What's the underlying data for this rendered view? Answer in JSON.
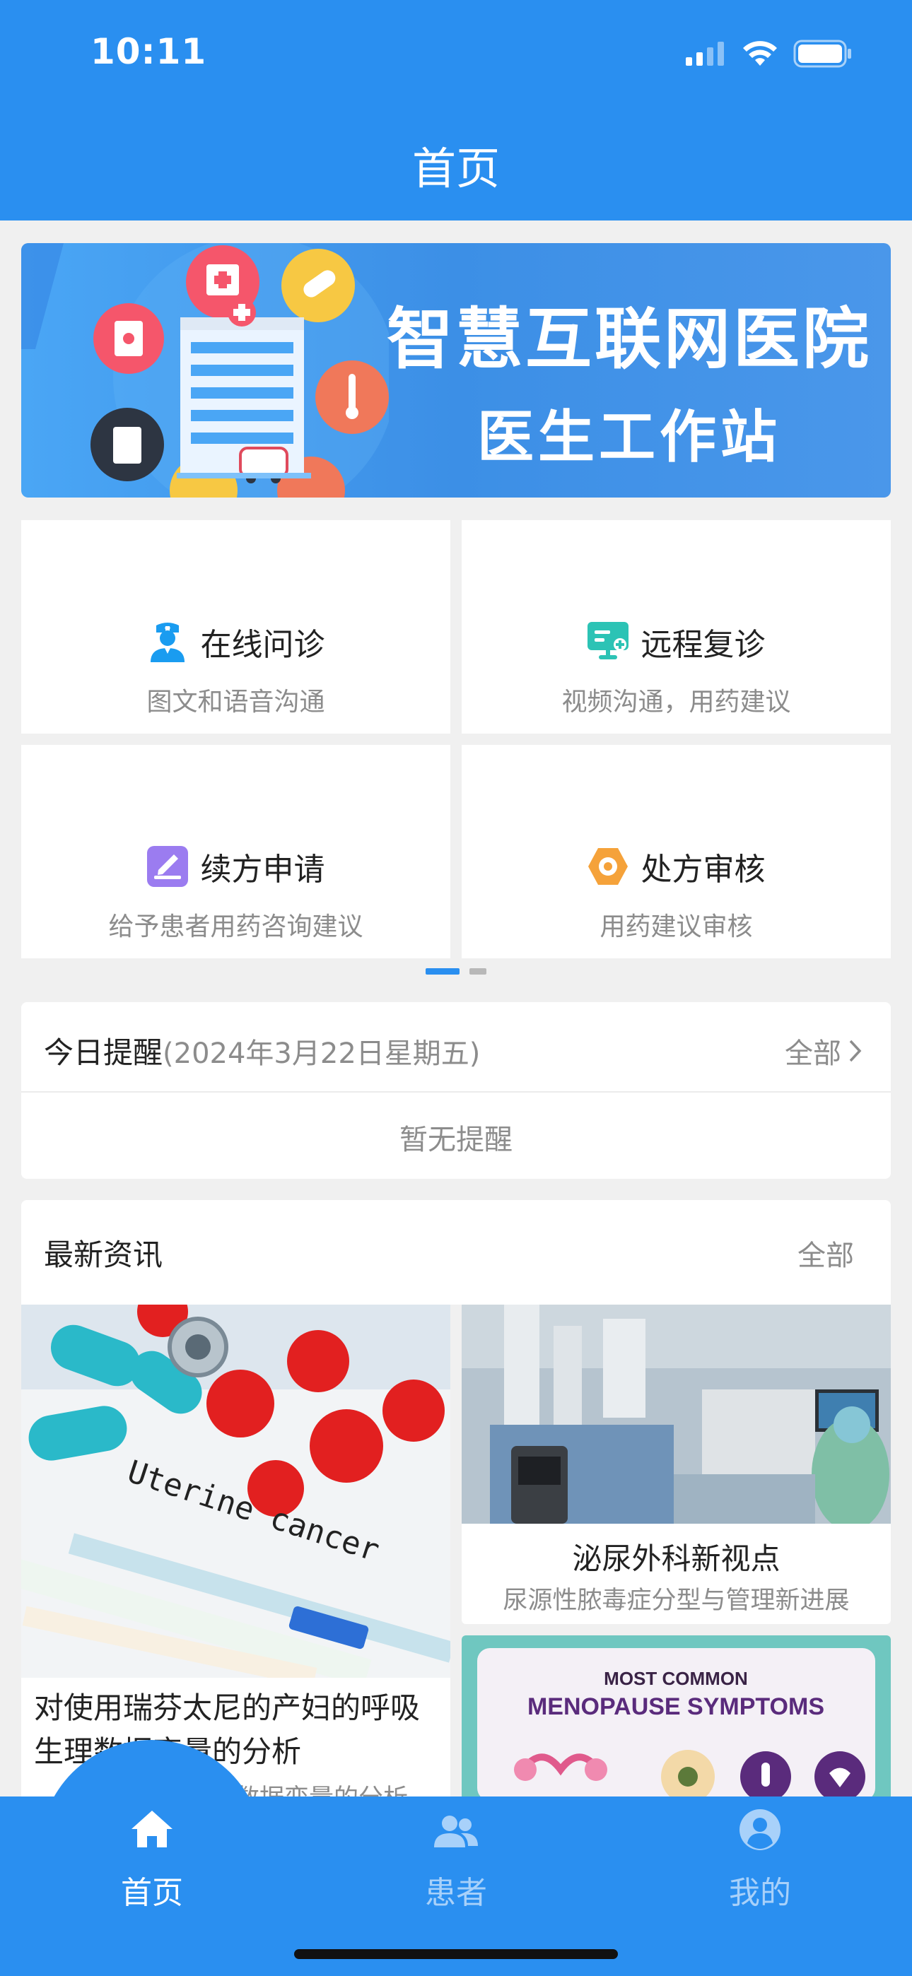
{
  "status_bar": {
    "time": "10:11"
  },
  "nav": {
    "title": "首页"
  },
  "banner": {
    "title": "智慧互联网医院",
    "subtitle": "医生工作站"
  },
  "services": [
    {
      "title": "在线问诊",
      "desc": "图文和语音沟通",
      "icon": "nurse-icon",
      "color": "#1a9cf0"
    },
    {
      "title": "远程复诊",
      "desc": "视频沟通，用药建议",
      "icon": "monitor-icon",
      "color": "#2cc3b5"
    },
    {
      "title": "续方申请",
      "desc": "给予患者用药咨询建议",
      "icon": "edit-note-icon",
      "color": "#9b7cf0"
    },
    {
      "title": "处方审核",
      "desc": "用药建议审核",
      "icon": "hexagon-icon",
      "color": "#f5a23a"
    }
  ],
  "reminder": {
    "title": "今日提醒",
    "date": "(2024年3月22日星期五)",
    "all_label": "全部",
    "empty_text": "暂无提醒"
  },
  "news": {
    "title": "最新资讯",
    "all_label": "全部",
    "items": [
      {
        "title": "对使用瑞芬太尼的产妇的呼吸生理数据变量的分析",
        "subtitle": "呼吸生理数据变量的分析",
        "image_label": "Uterine cancer"
      },
      {
        "title": "泌尿外科新视点",
        "subtitle": "尿源性脓毒症分型与管理新进展"
      },
      {
        "image_label_top": "MOST COMMON",
        "image_label_main": "MENOPAUSE SYMPTOMS"
      }
    ]
  },
  "tabbar": {
    "items": [
      {
        "label": "首页",
        "icon": "home-icon"
      },
      {
        "label": "患者",
        "icon": "patients-icon"
      },
      {
        "label": "我的",
        "icon": "profile-icon"
      }
    ]
  },
  "colors": {
    "primary": "#2a8ff0",
    "muted_text": "#8c8c8c",
    "tab_inactive": "#a8d1fa"
  }
}
